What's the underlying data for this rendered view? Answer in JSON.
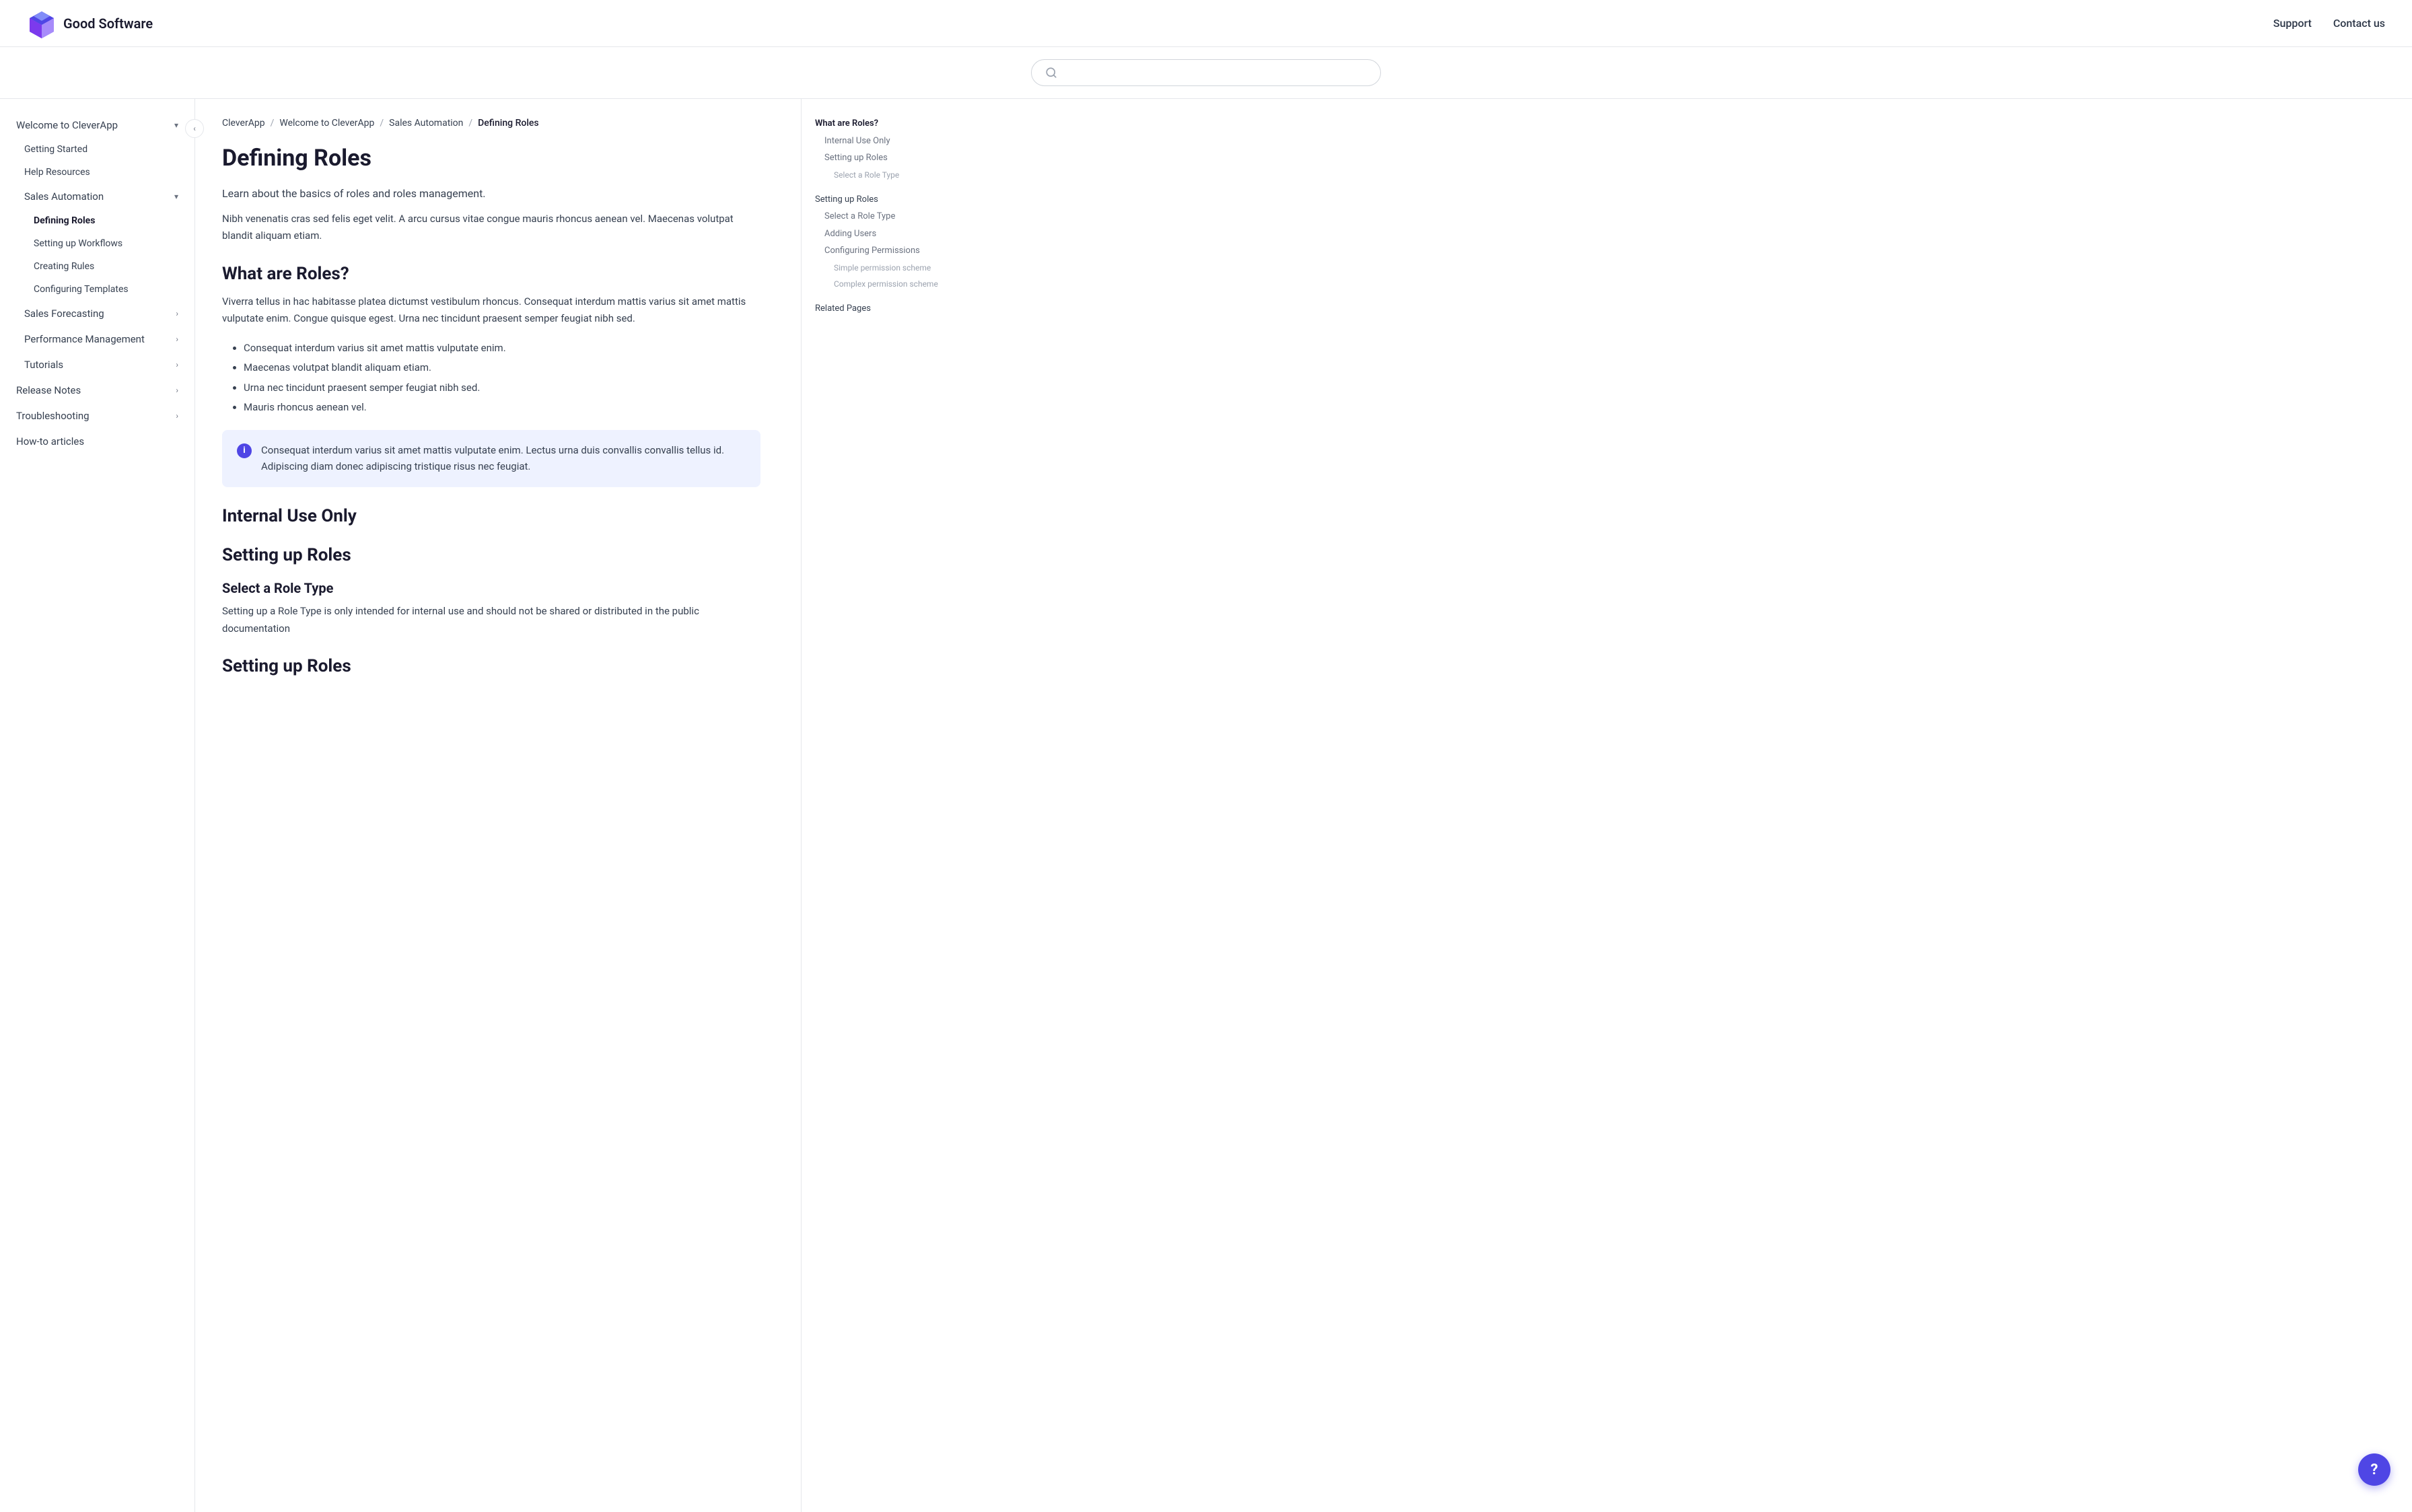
{
  "header": {
    "logo_text": "Good Software",
    "nav": {
      "support": "Support",
      "contact": "Contact us"
    }
  },
  "search": {
    "placeholder": ""
  },
  "sidebar": {
    "toggle_icon": "‹",
    "top_items": [
      {
        "id": "welcome",
        "label": "Welcome to CleverApp",
        "expanded": true,
        "has_chevron": true,
        "chevron_dir": "down"
      },
      {
        "id": "getting-started",
        "label": "Getting Started",
        "indent": 1
      },
      {
        "id": "help-resources",
        "label": "Help Resources",
        "indent": 1
      },
      {
        "id": "sales-automation",
        "label": "Sales Automation",
        "indent": 1,
        "expanded": true,
        "has_chevron": true,
        "chevron_dir": "down"
      },
      {
        "id": "defining-roles",
        "label": "Defining Roles",
        "indent": 2,
        "active": true
      },
      {
        "id": "setting-up-workflows",
        "label": "Setting up Workflows",
        "indent": 2
      },
      {
        "id": "creating-rules",
        "label": "Creating Rules",
        "indent": 2
      },
      {
        "id": "configuring-templates",
        "label": "Configuring Templates",
        "indent": 2
      },
      {
        "id": "sales-forecasting",
        "label": "Sales Forecasting",
        "indent": 1,
        "has_chevron": true,
        "chevron_dir": "right"
      },
      {
        "id": "performance-management",
        "label": "Performance Management",
        "indent": 1,
        "has_chevron": true,
        "chevron_dir": "right"
      },
      {
        "id": "tutorials",
        "label": "Tutorials",
        "indent": 1,
        "has_chevron": true,
        "chevron_dir": "right"
      },
      {
        "id": "release-notes",
        "label": "Release Notes",
        "indent": 0,
        "has_chevron": true,
        "chevron_dir": "right"
      },
      {
        "id": "troubleshooting",
        "label": "Troubleshooting",
        "indent": 0,
        "has_chevron": true,
        "chevron_dir": "right"
      },
      {
        "id": "how-to-articles",
        "label": "How-to articles",
        "indent": 0
      }
    ]
  },
  "breadcrumb": {
    "items": [
      "CleverApp",
      "Welcome to CleverApp",
      "Sales Automation",
      "Defining Roles"
    ]
  },
  "article": {
    "title": "Defining Roles",
    "intro": "Learn about the basics of roles and roles management.",
    "body1": "Nibh venenatis cras sed felis eget velit. A arcu cursus vitae congue mauris rhoncus aenean vel. Maecenas volutpat blandit aliquam etiam.",
    "h2_what": "What are Roles?",
    "body2": "Viverra tellus in hac habitasse platea dictumst vestibulum rhoncus. Consequat interdum mattis varius sit amet mattis vulputate enim. Congue quisque egest. Urna nec tincidunt praesent semper feugiat nibh sed.",
    "list_items": [
      "Consequat interdum varius sit amet mattis vulputate enim.",
      "Maecenas volutpat blandit aliquam etiam.",
      "Urna nec tincidunt praesent semper feugiat nibh sed.",
      "Mauris rhoncus aenean vel."
    ],
    "info_text": "Consequat interdum varius sit amet mattis vulputate enim. Lectus urna duis convallis convallis tellus id. Adipiscing diam donec adipiscing tristique risus nec feugiat.",
    "h2_internal": "Internal Use Only",
    "h2_setting": "Setting up Roles",
    "h3_select": "Select a Role Type",
    "body3": "Setting up a Role Type is only intended for internal use and should not be shared or distributed in the public documentation",
    "h2_setting2": "Setting up Roles"
  },
  "toc": {
    "items": [
      {
        "id": "toc-what",
        "label": "What are Roles?",
        "level": 0,
        "active": true
      },
      {
        "id": "toc-internal",
        "label": "Internal Use Only",
        "level": 1
      },
      {
        "id": "toc-setting1",
        "label": "Setting up Roles",
        "level": 1
      },
      {
        "id": "toc-select1",
        "label": "Select a Role Type",
        "level": 2
      },
      {
        "id": "toc-setting2",
        "label": "Setting up Roles",
        "level": 0
      },
      {
        "id": "toc-select2",
        "label": "Select a Role Type",
        "level": 1
      },
      {
        "id": "toc-adding",
        "label": "Adding Users",
        "level": 1
      },
      {
        "id": "toc-configuring",
        "label": "Configuring Permissions",
        "level": 1
      },
      {
        "id": "toc-simple",
        "label": "Simple permission scheme",
        "level": 2
      },
      {
        "id": "toc-complex",
        "label": "Complex permission scheme",
        "level": 2
      },
      {
        "id": "toc-related",
        "label": "Related Pages",
        "level": 0
      }
    ]
  },
  "help_fab": "?"
}
